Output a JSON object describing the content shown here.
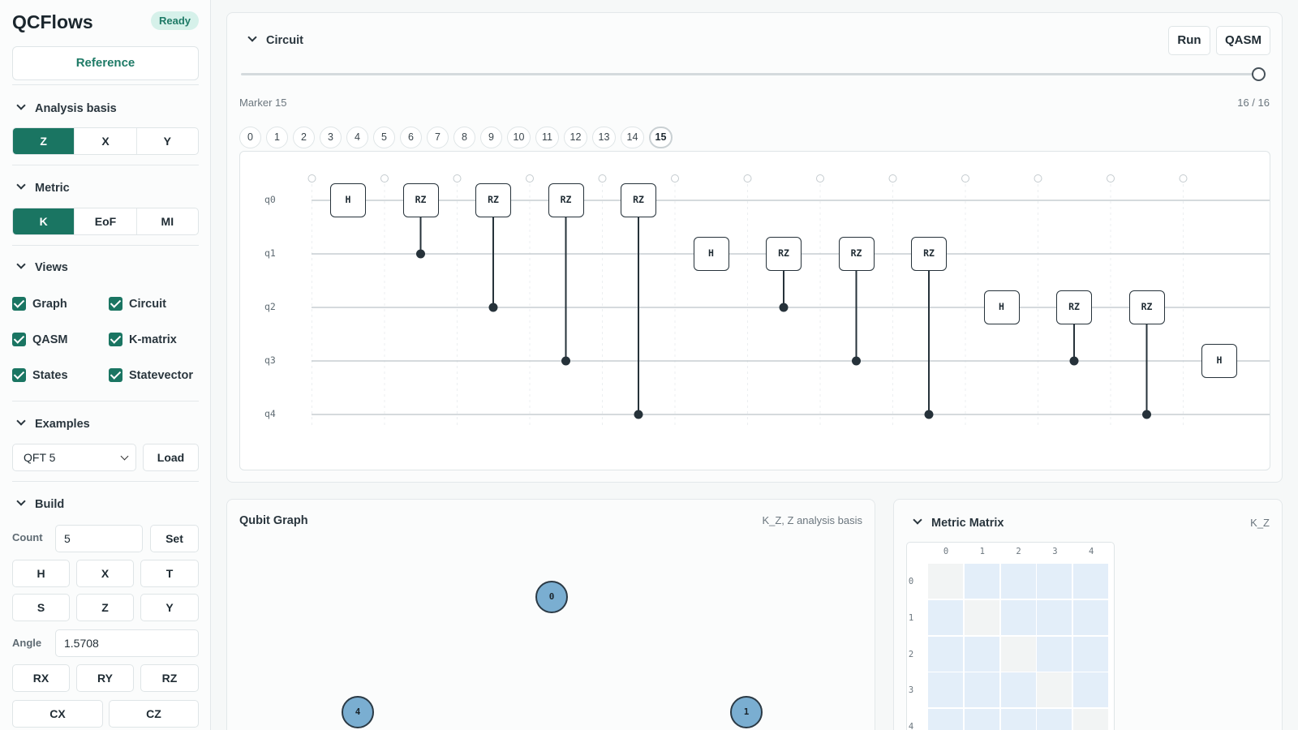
{
  "app": {
    "title": "QCFlows",
    "status": "Ready"
  },
  "sidebar": {
    "reference_label": "Reference",
    "analysis_basis": {
      "heading": "Analysis basis",
      "options": [
        "Z",
        "X",
        "Y"
      ],
      "selected": "Z"
    },
    "metric": {
      "heading": "Metric",
      "options": [
        "K",
        "EoF",
        "MI"
      ],
      "selected": "K"
    },
    "views": {
      "heading": "Views",
      "items": [
        {
          "label": "Graph",
          "checked": true
        },
        {
          "label": "Circuit",
          "checked": true
        },
        {
          "label": "QASM",
          "checked": true
        },
        {
          "label": "K-matrix",
          "checked": true
        },
        {
          "label": "States",
          "checked": true
        },
        {
          "label": "Statevector",
          "checked": true
        }
      ]
    },
    "examples": {
      "heading": "Examples",
      "selected": "QFT 5",
      "load_label": "Load"
    },
    "build": {
      "heading": "Build",
      "count_label": "Count",
      "count_value": "5",
      "set_label": "Set",
      "gates_row1": [
        "H",
        "X",
        "T"
      ],
      "gates_row2": [
        "S",
        "Z",
        "Y"
      ],
      "angle_label": "Angle",
      "angle_value": "1.5708",
      "rot_gates": [
        "RX",
        "RY",
        "RZ"
      ],
      "two_qubit": [
        "CX",
        "CZ"
      ]
    }
  },
  "circuit": {
    "heading": "Circuit",
    "run_label": "Run",
    "qasm_label": "QASM",
    "marker_label": "Marker 15",
    "progress_label": "16 / 16",
    "slider_fraction": 1.0,
    "markers": [
      "0",
      "1",
      "2",
      "3",
      "4",
      "5",
      "6",
      "7",
      "8",
      "9",
      "10",
      "11",
      "12",
      "13",
      "14",
      "15"
    ],
    "current_marker": "15",
    "qubits": [
      "q0",
      "q1",
      "q2",
      "q3",
      "q4"
    ],
    "gates": [
      {
        "name": "H",
        "qubit": 0,
        "step": 0
      },
      {
        "name": "RZ",
        "qubit": 0,
        "control": 1,
        "step": 1
      },
      {
        "name": "RZ",
        "qubit": 0,
        "control": 2,
        "step": 2
      },
      {
        "name": "RZ",
        "qubit": 0,
        "control": 3,
        "step": 3
      },
      {
        "name": "RZ",
        "qubit": 0,
        "control": 4,
        "step": 4
      },
      {
        "name": "H",
        "qubit": 1,
        "step": 5
      },
      {
        "name": "RZ",
        "qubit": 1,
        "control": 2,
        "step": 6
      },
      {
        "name": "RZ",
        "qubit": 1,
        "control": 3,
        "step": 7
      },
      {
        "name": "RZ",
        "qubit": 1,
        "control": 4,
        "step": 8
      },
      {
        "name": "H",
        "qubit": 2,
        "step": 9
      },
      {
        "name": "RZ",
        "qubit": 2,
        "control": 3,
        "step": 10
      },
      {
        "name": "RZ",
        "qubit": 2,
        "control": 4,
        "step": 11
      },
      {
        "name": "H",
        "qubit": 3,
        "step": 12
      }
    ]
  },
  "graph": {
    "heading": "Qubit Graph",
    "subtitle": "K_Z, Z analysis basis",
    "nodes": [
      "0",
      "1",
      "4"
    ]
  },
  "matrix": {
    "heading": "Metric Matrix",
    "subtitle": "K_Z",
    "labels": [
      "0",
      "1",
      "2",
      "3",
      "4"
    ],
    "colors": {
      "diagonal": "#f2f4f4",
      "offdiag": "#e3eef9"
    }
  },
  "colors": {
    "accent": "#1a7562",
    "wire": "#c7ced2",
    "gate_border": "#26323a",
    "node_fill": "#7aaed1"
  }
}
